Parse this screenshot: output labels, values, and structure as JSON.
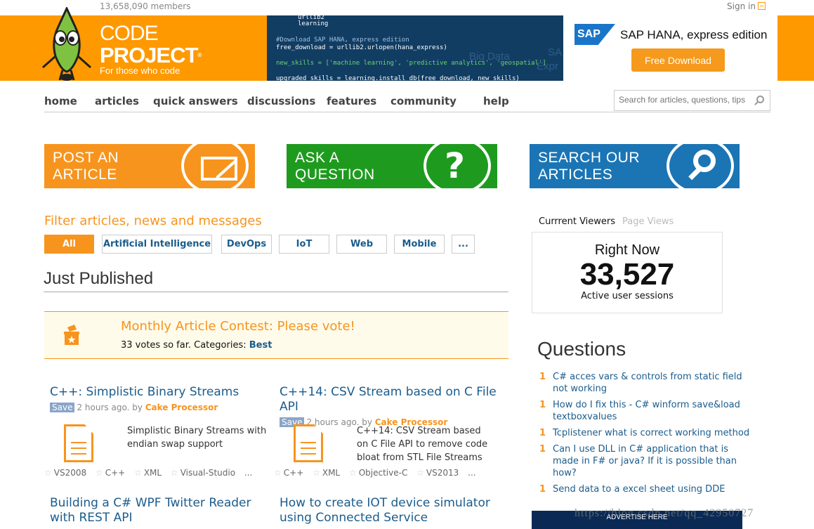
{
  "topbar": {
    "members": "13,658,090 members",
    "signin": "Sign in"
  },
  "logo": {
    "line1": "CODE",
    "line2": "PROJECT",
    "reg": "®",
    "tagline": "For those who code"
  },
  "ad": {
    "code_lines": [
      "urllib2",
      "learning",
      "#Download SAP HANA, express edition",
      "free_download = urllib2.urlopen(hana_express)",
      "new_skills = ['machine learning', 'predictive analytics', 'geospatial']",
      "upgraded_skills = learning.install_db(free_download, new_skills)"
    ],
    "bg_words": [
      "Big Data",
      "SA",
      "Expr"
    ],
    "brand": "SAP",
    "title": "SAP HANA, express edition",
    "button": "Free Download"
  },
  "nav": {
    "items": [
      "home",
      "articles",
      "quick answers",
      "discussions",
      "features",
      "community",
      "help"
    ],
    "search_placeholder": "Search for articles, questions, tips"
  },
  "cta": {
    "post": "POST AN\nARTICLE",
    "ask": "ASK A\nQUESTION",
    "search": "SEARCH OUR\nARTICLES"
  },
  "filter": {
    "title": "Filter articles, news and messages",
    "items": [
      "All",
      "Artificial Intelligence",
      "DevOps",
      "IoT",
      "Web",
      "Mobile",
      "..."
    ],
    "active": "All"
  },
  "just_published": "Just Published",
  "contest": {
    "title": "Monthly Article Contest: Please vote!",
    "sub_prefix": "33 votes so far. Categories: ",
    "category": "Best"
  },
  "articles": [
    {
      "title": "C++: Simplistic Binary Streams",
      "save": "Save",
      "time": "2 hours ago. by ",
      "author": "Cake Processor",
      "desc": "Simplistic Binary Streams with endian swap support",
      "tags": [
        "VS2008",
        "C++",
        "XML",
        "Visual-Studio"
      ],
      "more": "..."
    },
    {
      "title": "C++14: CSV Stream based on C File API",
      "save": "Save",
      "time": "2 hours ago. by ",
      "author": "Cake Processor",
      "desc": "C++14: CSV Stream based on C File API to remove code bloat from STL File Streams",
      "tags": [
        "C++",
        "XML",
        "Objective-C",
        "VS2013"
      ],
      "more": "..."
    }
  ],
  "articles_more": [
    "Building a C# WPF Twitter Reader with REST API",
    "How to create IOT device simulator using Connected Service"
  ],
  "viewers": {
    "tab_current": "Currrent Viewers",
    "tab_views": "Page Views",
    "right_now": "Right Now",
    "count": "33,527",
    "label": "Active user sessions"
  },
  "questions": {
    "title": "Questions",
    "items": [
      {
        "n": "1",
        "text": "C# acces vars & controls from static field not working"
      },
      {
        "n": "1",
        "text": "How do I fix this - C# winform save&load textboxvalues"
      },
      {
        "n": "1",
        "text": "Tcplistener what is correct working method"
      },
      {
        "n": "1",
        "text": "Can I use DLL in C# application that is made in F# or java? If it is possible than how?"
      },
      {
        "n": "1",
        "text": "Send data to a excel sheet using DDE"
      }
    ]
  },
  "advert": "ADVERTISE HERE",
  "watermark": "https://blog.csdn.net/qq_42950727",
  "colors": {
    "orange": "#f7941d",
    "green": "#1e9b1e",
    "blue": "#1b75b4",
    "link": "#1b5c8c"
  }
}
